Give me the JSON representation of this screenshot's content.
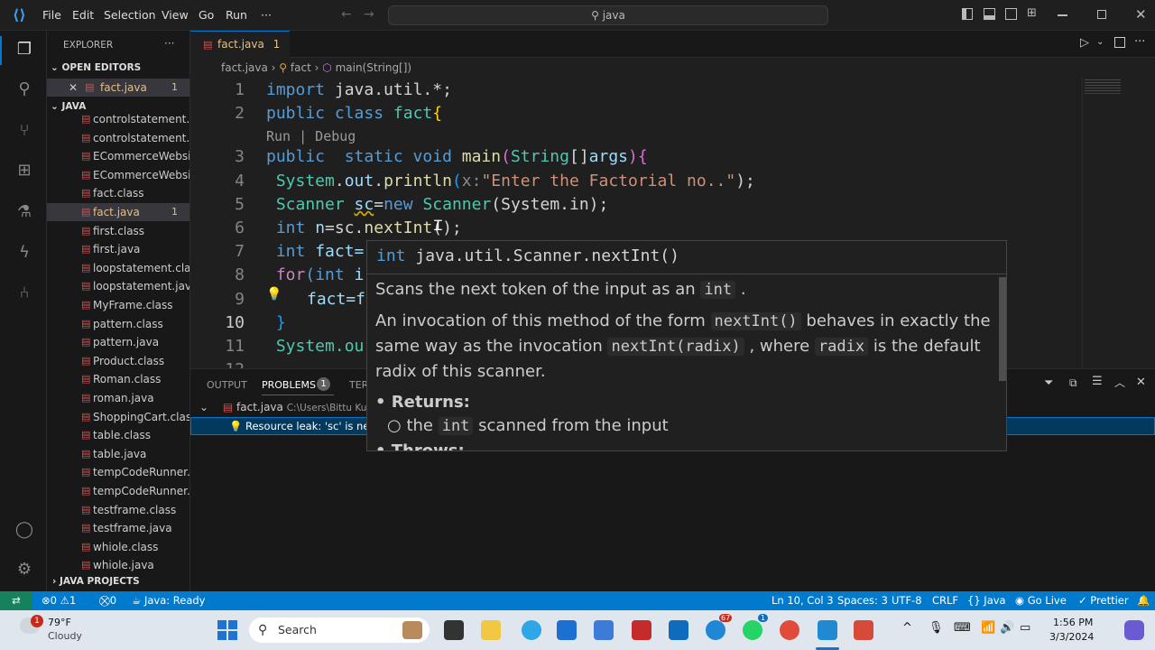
{
  "titlebar": {
    "menus": [
      "File",
      "Edit",
      "Selection",
      "View",
      "Go",
      "Run",
      "···"
    ],
    "search": "java"
  },
  "sidebar": {
    "title": "EXPLORER",
    "more": "···",
    "open_editors_label": "OPEN EDITORS",
    "open_editor": {
      "name": "fact.java",
      "badge": "1"
    },
    "folder_label": "JAVA",
    "files": [
      {
        "name": "controlstatement...."
      },
      {
        "name": "controlstatement.j..."
      },
      {
        "name": "ECommerceWebsi..."
      },
      {
        "name": "ECommerceWebsi..."
      },
      {
        "name": "fact.class"
      },
      {
        "name": "fact.java",
        "badge": "1"
      },
      {
        "name": "first.class"
      },
      {
        "name": "first.java"
      },
      {
        "name": "loopstatement.class"
      },
      {
        "name": "loopstatement.java"
      },
      {
        "name": "MyFrame.class"
      },
      {
        "name": "pattern.class"
      },
      {
        "name": "pattern.java"
      },
      {
        "name": "Product.class"
      },
      {
        "name": "Roman.class"
      },
      {
        "name": "roman.java"
      },
      {
        "name": "ShoppingCart.class"
      },
      {
        "name": "table.class"
      },
      {
        "name": "table.java"
      },
      {
        "name": "tempCodeRunner...."
      },
      {
        "name": "tempCodeRunner...."
      },
      {
        "name": "testframe.class"
      },
      {
        "name": "testframe.java"
      },
      {
        "name": "whiole.class"
      },
      {
        "name": "whiole.java"
      }
    ],
    "java_projects_label": "JAVA PROJECTS"
  },
  "editor": {
    "tab": {
      "name": "fact.java",
      "badge": "1",
      "close": "✕"
    },
    "breadcrumb": {
      "file": "fact.java",
      "cls": "fact",
      "method": "main(String[])"
    },
    "codelens": "Run | Debug",
    "line_numbers": [
      "1",
      "2",
      "3",
      "4",
      "5",
      "6",
      "7",
      "8",
      "9",
      "10",
      "11",
      "12"
    ],
    "lines": {
      "l1a": "import",
      "l1b": " java.util.*;",
      "l2a": "public class ",
      "l2b": "fact",
      "l2c": "{",
      "l3a": "public  static void ",
      "l3b": "main",
      "l3c": "(",
      "l3d": "String",
      "l3e": "[]",
      "l3f": "args",
      "l3g": "){",
      "l4a": " System",
      "l4b": ".",
      "l4c": "out",
      "l4d": ".",
      "l4e": "println",
      "l4f": "(",
      "l4g": "x:",
      "l4h": "\"Enter the Factorial no..\"",
      "l4i": ");",
      "l5a": " Scanner ",
      "l5b": "sc",
      "l5c": "=",
      "l5d": "new ",
      "l5e": "Scanner",
      "l5f": "(System.in);",
      "l6a": " int ",
      "l6b": "n",
      "l6c": "=sc.",
      "l6d": "nextInt",
      "l6e": "();",
      "l7a": " int ",
      "l7b": "fact=",
      "l8a": " for",
      "l8b": "(int ",
      "l8c": "i",
      "l9a": "fact=f",
      "l10a": " }",
      "l11a": " System.ou"
    }
  },
  "hover": {
    "sig_kw": "int",
    "sig": "java.util.Scanner.nextInt()",
    "p1a": "Scans the next token of the input as an ",
    "p1b": "int",
    "p1c": " .",
    "p2a": "An invocation of this method of the form ",
    "p2b": "nextInt()",
    "p2c": " behaves in exactly the",
    "p3a": "same way as the invocation ",
    "p3b": "nextInt(radix)",
    "p3c": " , where ",
    "p3d": "radix",
    "p3e": " is the default",
    "p4": "radix of this scanner.",
    "returns": "Returns:",
    "r1a": "the ",
    "r1b": "int",
    "r1c": " scanned from the input",
    "throws": "Throws:"
  },
  "panel": {
    "tabs": [
      "OUTPUT",
      "PROBLEMS",
      "TERI"
    ],
    "problems_count": "1",
    "file_row": {
      "name": "fact.java",
      "path": "C:\\Users\\Bittu Kuma"
    },
    "problem": "Resource leak: 'sc' is neve"
  },
  "status": {
    "errors": "0",
    "warnings": "1",
    "ports": "0",
    "java": "Java: Ready",
    "position": "Ln 10, Col 3",
    "spaces": "Spaces: 3",
    "encoding": "UTF-8",
    "eol": "CRLF",
    "language": "Java",
    "golive": "Go Live",
    "prettier": "Prettier"
  },
  "taskbar": {
    "weather_temp": "79°F",
    "weather_desc": "Cloudy",
    "weather_badge": "1",
    "search": "Search",
    "time": "1:56 PM",
    "date": "3/3/2024",
    "badge1": "67",
    "badge2": "1"
  },
  "colors": {
    "accent": "#007acc",
    "editor_bg": "#1f1f1f",
    "sidebar_bg": "#181818",
    "warning": "#e2c08d"
  }
}
